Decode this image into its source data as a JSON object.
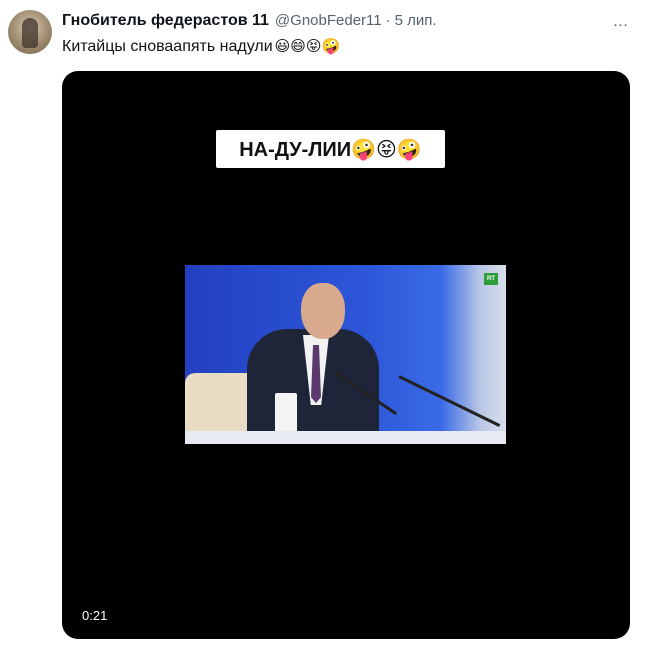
{
  "tweet": {
    "author_name": "Гнобитель федерастов 11",
    "handle": "@GnobFeder11",
    "separator": "·",
    "date": "5 лип.",
    "more_icon": "…",
    "text": "Китайцы сноваапять надули",
    "text_emojis": "😃😄😝🤪"
  },
  "video": {
    "caption": "НА-ДУ-ЛИИ🤪😝🤪",
    "channel_logo": "RT",
    "duration": "0:21"
  }
}
